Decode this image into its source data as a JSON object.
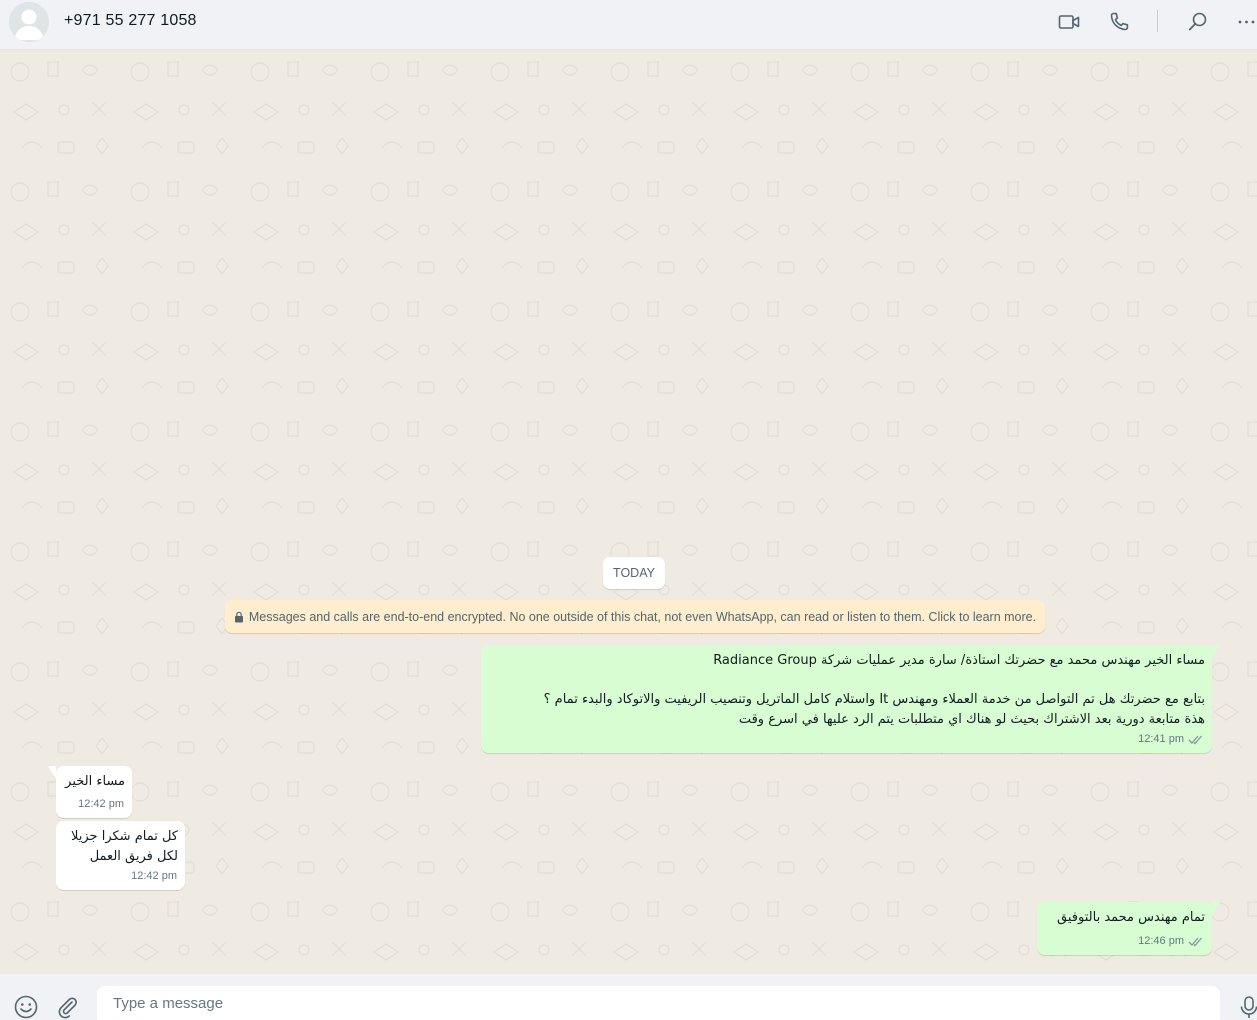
{
  "header": {
    "contact_name": "+971 55 277 1058",
    "icons": [
      "video-call-icon",
      "voice-call-icon",
      "search-icon",
      "menu-icon"
    ]
  },
  "chat": {
    "date_chip": "TODAY",
    "encryption_notice": "Messages and calls are end-to-end encrypted. No one outside of this chat, not even WhatsApp, can read or listen to them. Click to learn more.",
    "messages": [
      {
        "direction": "outgoing",
        "text": "مساء الخير مهندس محمد مع حضرتك استاذة/ سارة مدير عمليات شركة Radiance Group\n\nبتابع مع حضرتك هل تم التواصل من خدمة العملاء ومهندس It واستلام كامل الماتريل وتنصيب الريفيت والاتوكاد والبدء تمام ؟\nهذة متابعة دورية بعد الاشتراك بحيث لو هناك اي متطلبات يتم الرد عليها في اسرع وقت",
        "time": "12:41 pm",
        "status": "read"
      },
      {
        "direction": "incoming",
        "text": "مساء الخير",
        "time": "12:42 pm"
      },
      {
        "direction": "incoming",
        "text": "كل تمام شكرا جزيلا\nلكل فريق العمل",
        "time": "12:42 pm"
      },
      {
        "direction": "outgoing",
        "text": "تمام مهندس محمد بالتوفيق",
        "time": "12:46 pm",
        "status": "read"
      }
    ]
  },
  "composer": {
    "placeholder": "Type a message",
    "icons": [
      "emoji-icon",
      "attach-icon",
      "microphone-icon"
    ]
  },
  "colors": {
    "header_bg": "#f0f2f5",
    "chat_bg": "#efeae2",
    "outgoing_bubble": "#d9fdd3",
    "incoming_bubble": "#ffffff",
    "encryption_notice_bg": "#ffeecd",
    "read_ticks": "#8696a0"
  }
}
